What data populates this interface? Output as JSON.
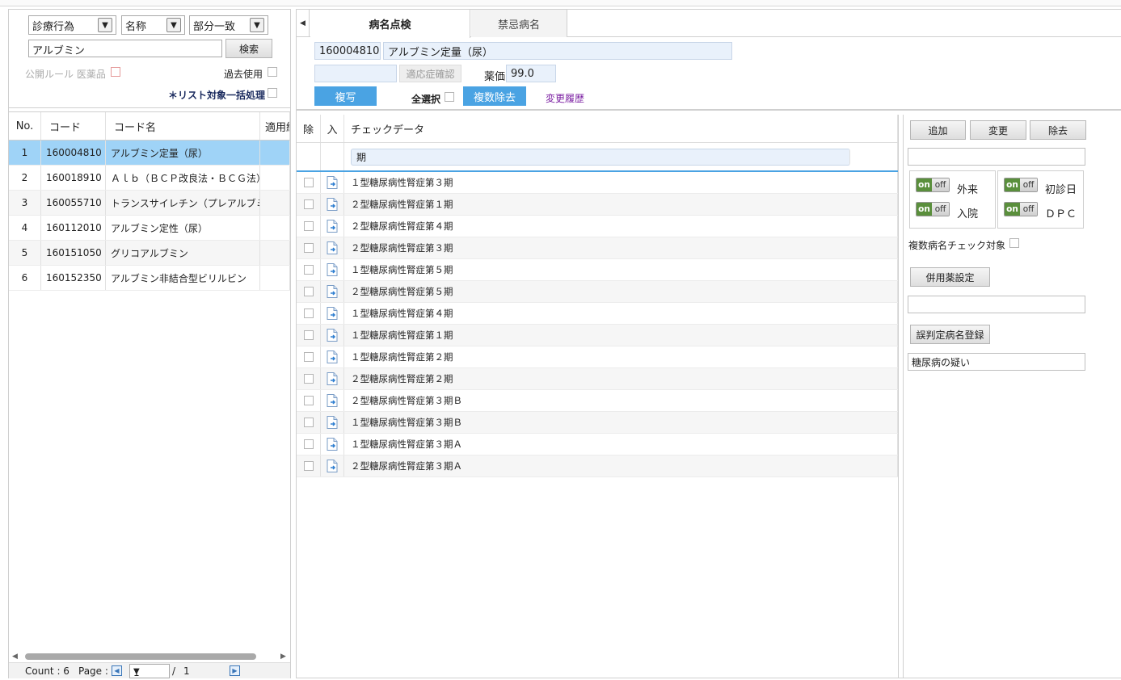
{
  "search": {
    "category": "診療行為",
    "field": "名称",
    "match": "部分一致",
    "keyword": "アルブミン",
    "search_button": "検索",
    "public_rule_label": "公開ルール 医薬品",
    "past_use_label": "過去使用",
    "bulk_label": "＊リスト対象一括処理"
  },
  "left_table": {
    "headers": [
      "No.",
      "コード",
      "コード名",
      "適用終"
    ],
    "rows": [
      {
        "no": "1",
        "code": "160004810",
        "name": "アルブミン定量（尿）"
      },
      {
        "no": "2",
        "code": "160018910",
        "name": "Ａｌｂ（ＢＣＰ改良法・ＢＣＧ法）"
      },
      {
        "no": "3",
        "code": "160055710",
        "name": "トランスサイレチン（プレアルブミン）"
      },
      {
        "no": "4",
        "code": "160112010",
        "name": "アルブミン定性（尿）"
      },
      {
        "no": "5",
        "code": "160151050",
        "name": "グリコアルブミン"
      },
      {
        "no": "6",
        "code": "160152350",
        "name": "アルブミン非結合型ビリルビン"
      }
    ]
  },
  "pager": {
    "count_label": "Count : 6",
    "page_label": "Page :",
    "page_value": "1",
    "separator": "/",
    "total": "1"
  },
  "tabs": [
    "病名点検",
    "禁忌病名"
  ],
  "info": {
    "code": "160004810",
    "name": "アルブミン定量（尿）",
    "indication_button": "適応症確認",
    "price_label": "薬価",
    "price_value": "99.0",
    "copy_button": "複写",
    "select_all_label": "全選択",
    "multi_remove_button": "複数除去",
    "history_link": "変更履歴"
  },
  "check_table": {
    "headers": {
      "del": "除",
      "in": "入",
      "data": "チェックデータ"
    },
    "filter": "期",
    "rows": [
      "１型糖尿病性腎症第３期",
      "２型糖尿病性腎症第１期",
      "２型糖尿病性腎症第４期",
      "２型糖尿病性腎症第３期",
      "１型糖尿病性腎症第５期",
      "２型糖尿病性腎症第５期",
      "１型糖尿病性腎症第４期",
      "１型糖尿病性腎症第１期",
      "１型糖尿病性腎症第２期",
      "２型糖尿病性腎症第２期",
      "２型糖尿病性腎症第３期Ｂ",
      "１型糖尿病性腎症第３期Ｂ",
      "１型糖尿病性腎症第３期Ａ",
      "２型糖尿病性腎症第３期Ａ"
    ]
  },
  "side": {
    "add_button": "追加",
    "change_button": "変更",
    "remove_button": "除去",
    "on_label": "on",
    "off_label": "off",
    "outpatient": "外来",
    "inpatient": "入院",
    "first_visit": "初診日",
    "dpc": "ＤＰＣ",
    "multi_check_label": "複数病名チェック対象",
    "combo_button": "併用薬設定",
    "misjudge_button": "誤判定病名登録",
    "misjudge_value": "糖尿病の疑い"
  },
  "colors": {
    "accent": "#4aa3e3",
    "selected_row": "#9fd3f7",
    "toggle_on": "#5a8f3c",
    "link": "#7b1fa2"
  }
}
